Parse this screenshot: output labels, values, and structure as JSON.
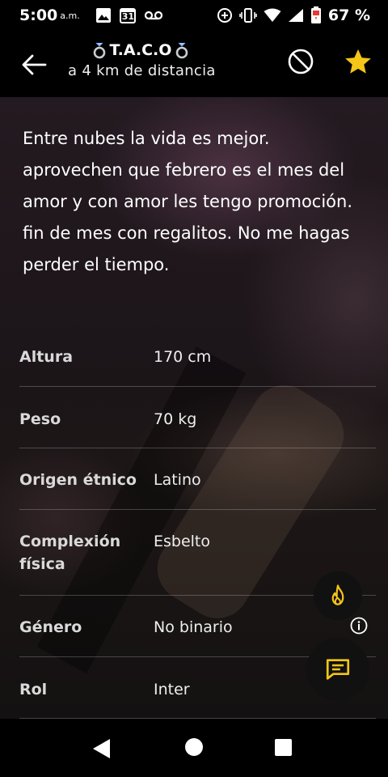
{
  "status_bar": {
    "time": "5:00",
    "ampm": "a.m.",
    "calendar_day": "31",
    "battery_percent": "67 %",
    "icons": [
      "image-icon",
      "calendar-icon",
      "voicemail-icon",
      "data-saver-icon",
      "vibrate-icon",
      "wifi-icon",
      "signal-icon",
      "battery-icon"
    ]
  },
  "header": {
    "title": "T.A.C.O",
    "distance": "a 4 km de distancia",
    "icons": [
      "back-arrow-icon",
      "ring-icon",
      "block-icon",
      "star-icon"
    ],
    "accent_color": "#f5c518"
  },
  "bio": "Entre nubes la vida es mejor. aprovechen que febrero es el mes del amor y con amor les tengo promoción. fin de mes con regalitos. No me hagas perder el tiempo.",
  "attributes": [
    {
      "label": "Altura",
      "value": "170 cm"
    },
    {
      "label": "Peso",
      "value": "70 kg"
    },
    {
      "label": "Origen étnico",
      "value": "Latino"
    },
    {
      "label": "Complexión física",
      "value": "Esbelto"
    },
    {
      "label": "Género",
      "value": "No binario"
    },
    {
      "label": "Rol",
      "value": "Inter"
    }
  ],
  "fabs": {
    "icons": [
      "flame-icon",
      "chat-icon",
      "info-icon"
    ]
  },
  "nav_bar": {
    "icons": [
      "nav-back-icon",
      "nav-home-icon",
      "nav-recents-icon"
    ]
  }
}
